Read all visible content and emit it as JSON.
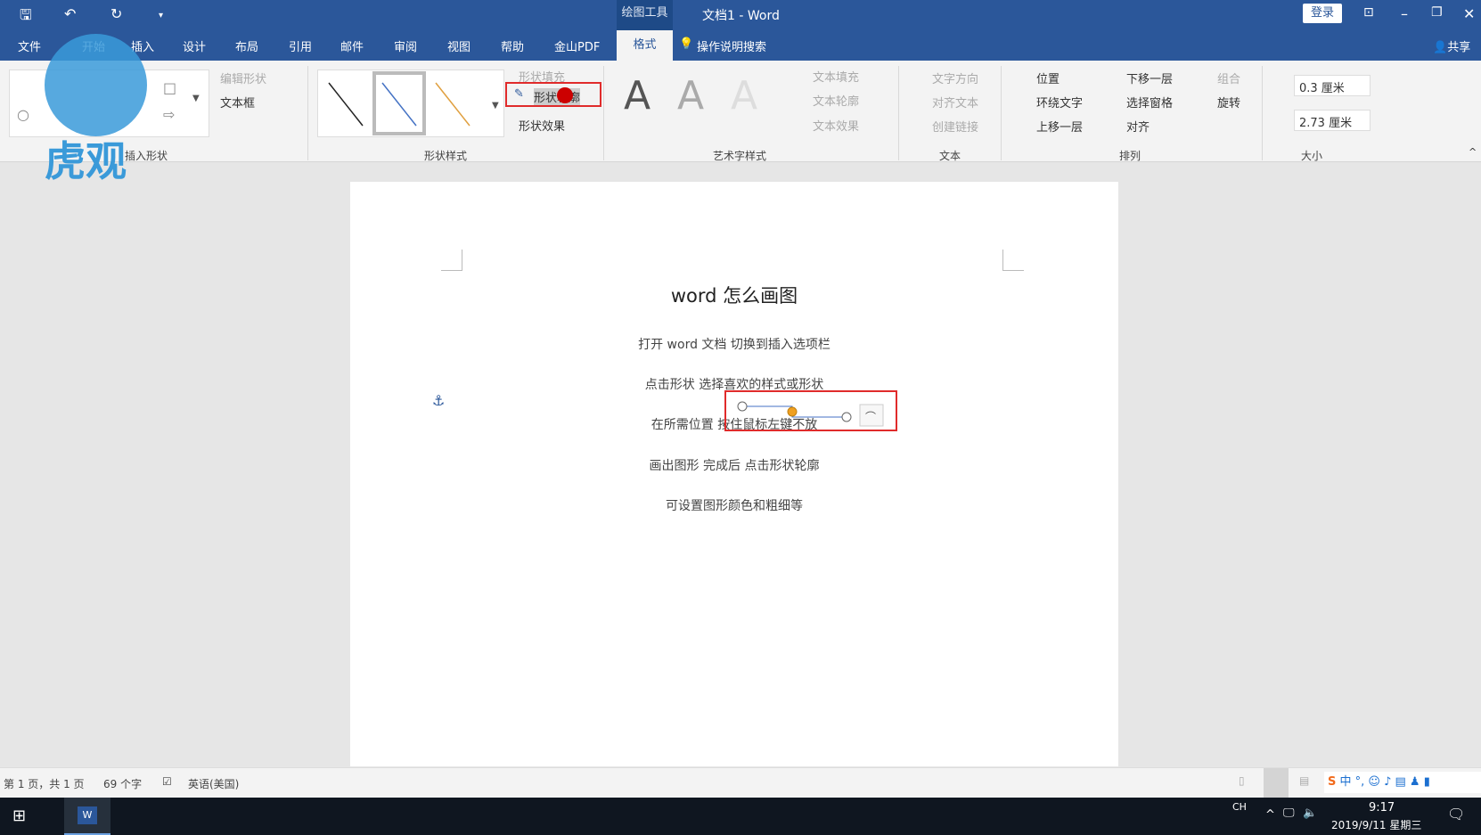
{
  "titlebar": {
    "context": "绘图工具",
    "title": "文档1  -  Word",
    "login": "登录"
  },
  "tabs": [
    "文件",
    "开始",
    "插入",
    "设计",
    "布局",
    "引用",
    "邮件",
    "审阅",
    "视图",
    "帮助",
    "金山PDF",
    "格式"
  ],
  "search": "操作说明搜索",
  "share": "共享",
  "ribbon": {
    "insert_shapes": {
      "edit_shape": "编辑形状",
      "textbox": "文本框",
      "label": "插入形状"
    },
    "shape_styles": {
      "fill": "形状填充",
      "outline": "形状轮廓",
      "effects": "形状效果",
      "label": "形状样式"
    },
    "wordart": {
      "letter": "A",
      "text_fill": "文本填充",
      "text_outline": "文本轮廓",
      "text_effects": "文本效果",
      "label": "艺术字样式"
    },
    "text": {
      "direction": "文字方向",
      "align": "对齐文本",
      "link": "创建链接",
      "label": "文本"
    },
    "arrange": {
      "position": "位置",
      "wrap": "环绕文字",
      "forward": "上移一层",
      "backward": "下移一层",
      "pane": "选择窗格",
      "align": "对齐",
      "group": "组合",
      "rotate": "旋转",
      "label": "排列"
    },
    "size": {
      "height": "0.3 厘米",
      "width": "2.73 厘米",
      "label": "大小"
    }
  },
  "document": {
    "title": "word 怎么画图",
    "lines": [
      "打开 word 文档   切换到插入选项栏",
      "点击形状   选择喜欢的样式或形状",
      "在所需位置   按住鼠标左键不放",
      "画出图形     完成后   点击形状轮廓",
      "可设置图形颜色和粗细等"
    ]
  },
  "status": {
    "page": "第 1 页，共 1 页",
    "words": "69 个字",
    "lang": "英语(美国)"
  },
  "taskbar": {
    "ime": "CH",
    "time": "9:17",
    "date": "2019/9/11 星期三"
  },
  "watermark": "虎观",
  "colors": {
    "brand": "#2b579a",
    "highlight": "#e02b2b"
  }
}
